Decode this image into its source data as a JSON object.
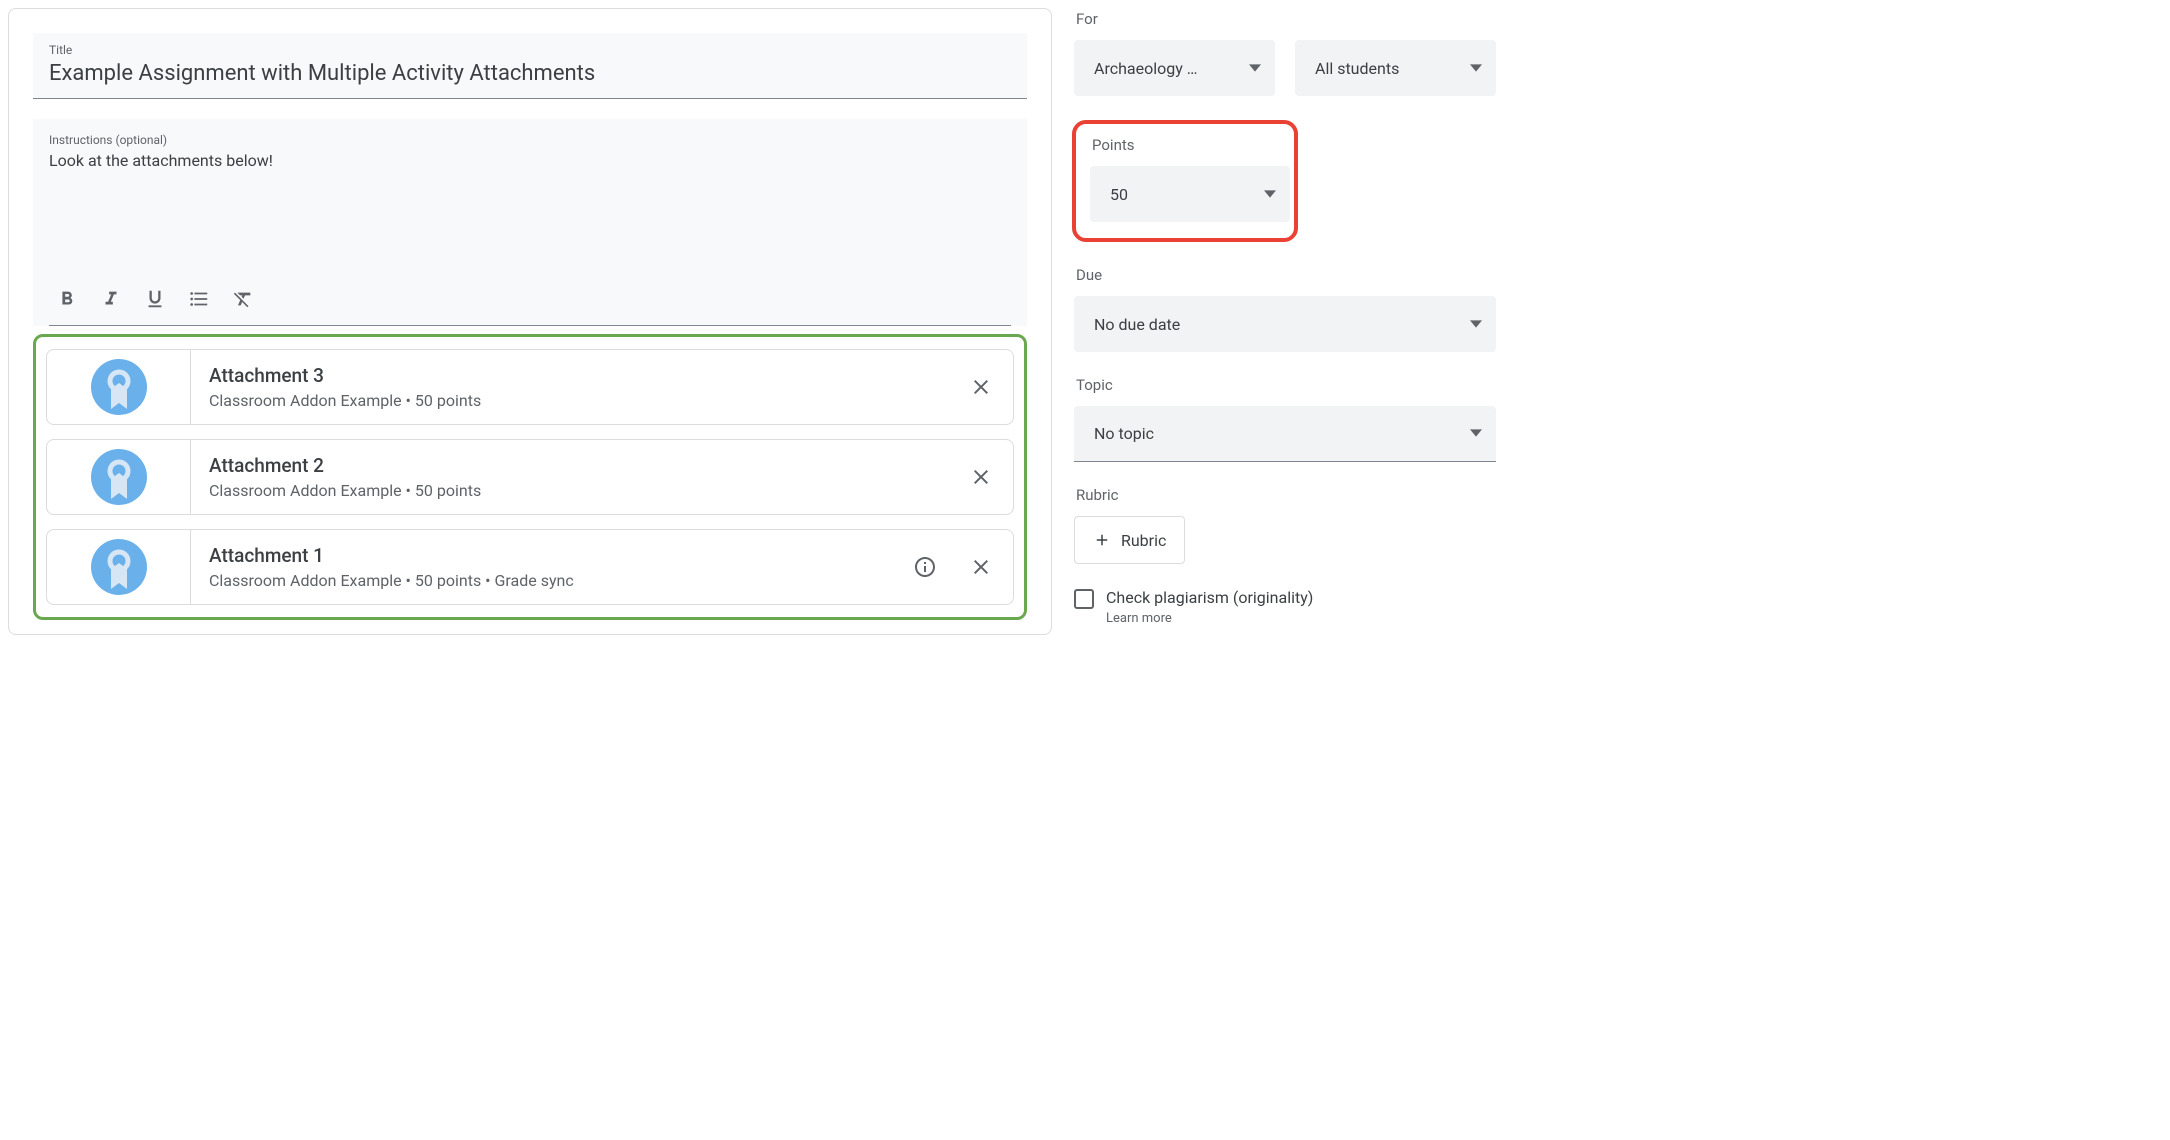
{
  "title": {
    "label": "Title",
    "value": "Example Assignment with Multiple Activity Attachments"
  },
  "instructions": {
    "label": "Instructions (optional)",
    "value": "Look at the attachments below!"
  },
  "attachments": [
    {
      "title": "Attachment 3",
      "subtitle": "Classroom Addon Example • 50 points",
      "has_info": false
    },
    {
      "title": "Attachment 2",
      "subtitle": "Classroom Addon Example • 50 points",
      "has_info": false
    },
    {
      "title": "Attachment 1",
      "subtitle": "Classroom Addon Example • 50 points • Grade sync",
      "has_info": true
    }
  ],
  "sidebar": {
    "for_label": "For",
    "class_dropdown": "Archaeology …",
    "students_dropdown": "All students",
    "points_label": "Points",
    "points_value": "50",
    "due_label": "Due",
    "due_value": "No due date",
    "topic_label": "Topic",
    "topic_value": "No topic",
    "rubric_label": "Rubric",
    "rubric_button": "Rubric",
    "plagiarism_label": "Check plagiarism (originality)",
    "learn_more": "Learn more"
  }
}
